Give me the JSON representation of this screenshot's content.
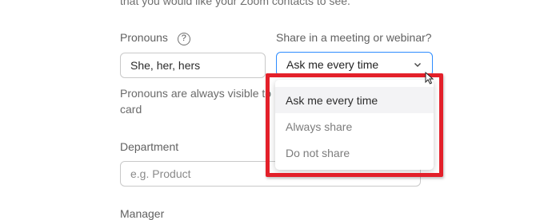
{
  "intro_text": "that you would like your Zoom contacts to see.",
  "pronouns": {
    "label": "Pronouns",
    "help_glyph": "?",
    "value": "She, her, hers",
    "note": "Pronouns are always visible to",
    "note_cont": "card"
  },
  "share": {
    "label": "Share in a meeting or webinar?",
    "selected": "Ask me every time",
    "options": [
      "Ask me every time",
      "Always share",
      "Do not share"
    ]
  },
  "department": {
    "label": "Department",
    "placeholder": "e.g. Product"
  },
  "manager": {
    "label": "Manager"
  },
  "colors": {
    "accent": "#2d8cff",
    "highlight": "#e3202a"
  }
}
